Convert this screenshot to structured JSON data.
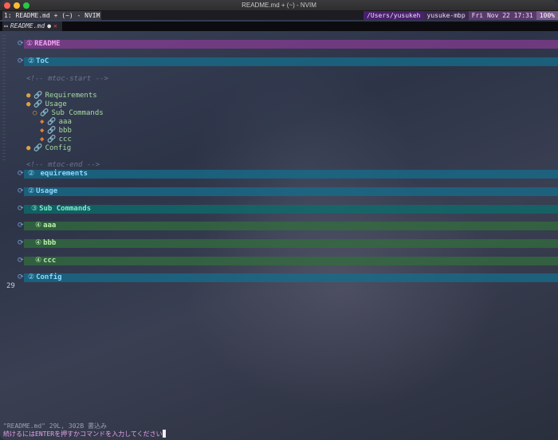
{
  "window": {
    "title": "README.md + (~) - NVIM"
  },
  "tmux": {
    "window_label": "1: README.md + (~) - NVIM",
    "new_window": "+",
    "path": "/Users/yusukeh",
    "host": "yusuke-mbp",
    "datetime": "Fri Nov 22 17:31",
    "battery": "100%"
  },
  "tabline": {
    "buffer_name": "README.md",
    "modified": "●",
    "close": "✕"
  },
  "editor": {
    "headings": {
      "readme": "README",
      "toc": "ToC",
      "requirements": " equirements",
      "usage": "Usage",
      "subcommands": "Sub Commands",
      "aaa": "aaa",
      "bbb": "bbb",
      "ccc": "ccc",
      "config": "Config"
    },
    "comment_start": "<!-- mtoc-start -->",
    "comment_end": "<!-- mtoc-end -->",
    "toc_items": {
      "requirements": "Requirements",
      "usage": "Usage",
      "subcommands": "Sub Commands",
      "aaa": "aaa",
      "bbb": "bbb",
      "ccc": "ccc",
      "config": "Config"
    },
    "line_number": "29"
  },
  "cmdline": {
    "file_info": "\"README.md\" 29L, 302B 書込み",
    "prompt": "続けるにはENTERを押すかコマンドを入力してください"
  },
  "colors": {
    "h1": "#8c3c96",
    "h2": "#146e8c",
    "h3": "#0a6e6e",
    "h4": "#326e3c"
  }
}
